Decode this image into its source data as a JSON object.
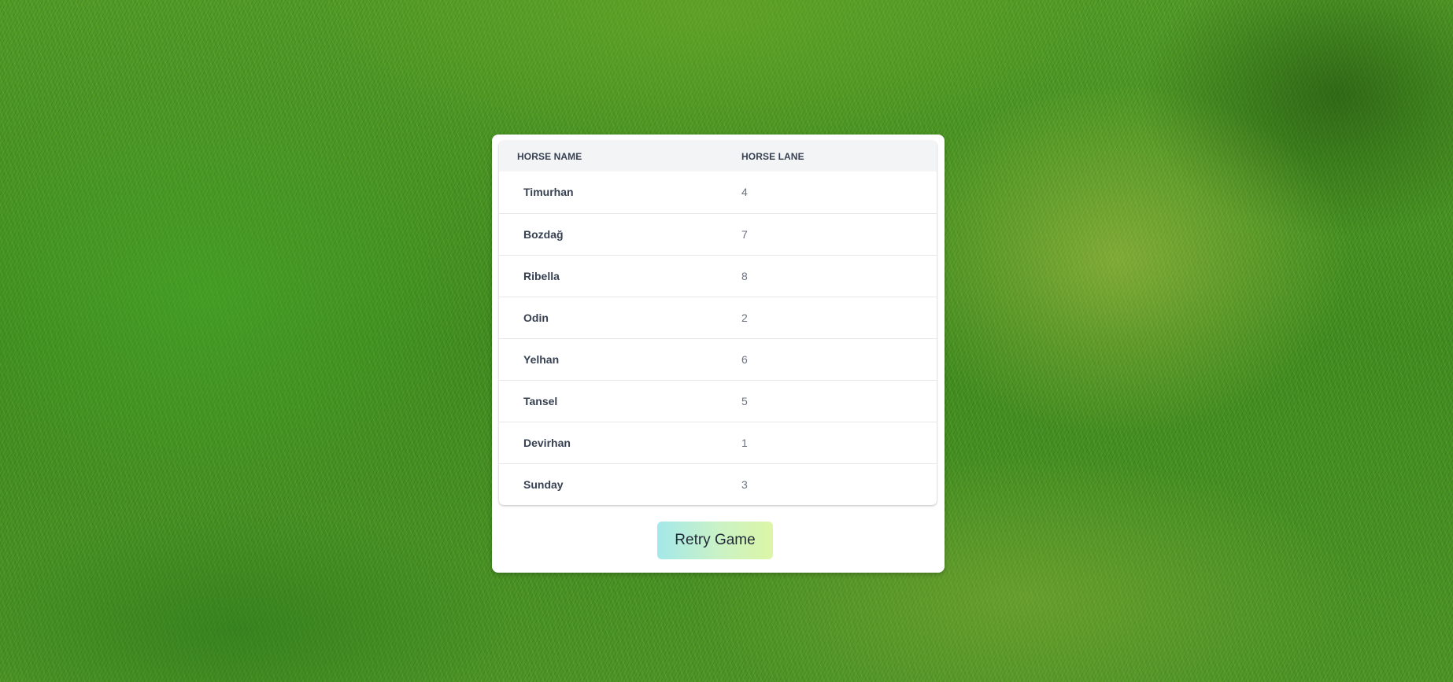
{
  "results_table": {
    "columns": {
      "name": "HORSE NAME",
      "lane": "HORSE LANE"
    },
    "rows": [
      {
        "name": "Timurhan",
        "lane": "4"
      },
      {
        "name": "Bozdağ",
        "lane": "7"
      },
      {
        "name": "Ribella",
        "lane": "8"
      },
      {
        "name": "Odin",
        "lane": "2"
      },
      {
        "name": "Yelhan",
        "lane": "6"
      },
      {
        "name": "Tansel",
        "lane": "5"
      },
      {
        "name": "Devirhan",
        "lane": "1"
      },
      {
        "name": "Sunday",
        "lane": "3"
      }
    ]
  },
  "retry_button": {
    "label": "Retry Game"
  },
  "colors": {
    "button_gradient_start": "#a4e8ea",
    "button_gradient_end": "#dcf6a6",
    "header_background": "#f3f4f6"
  }
}
